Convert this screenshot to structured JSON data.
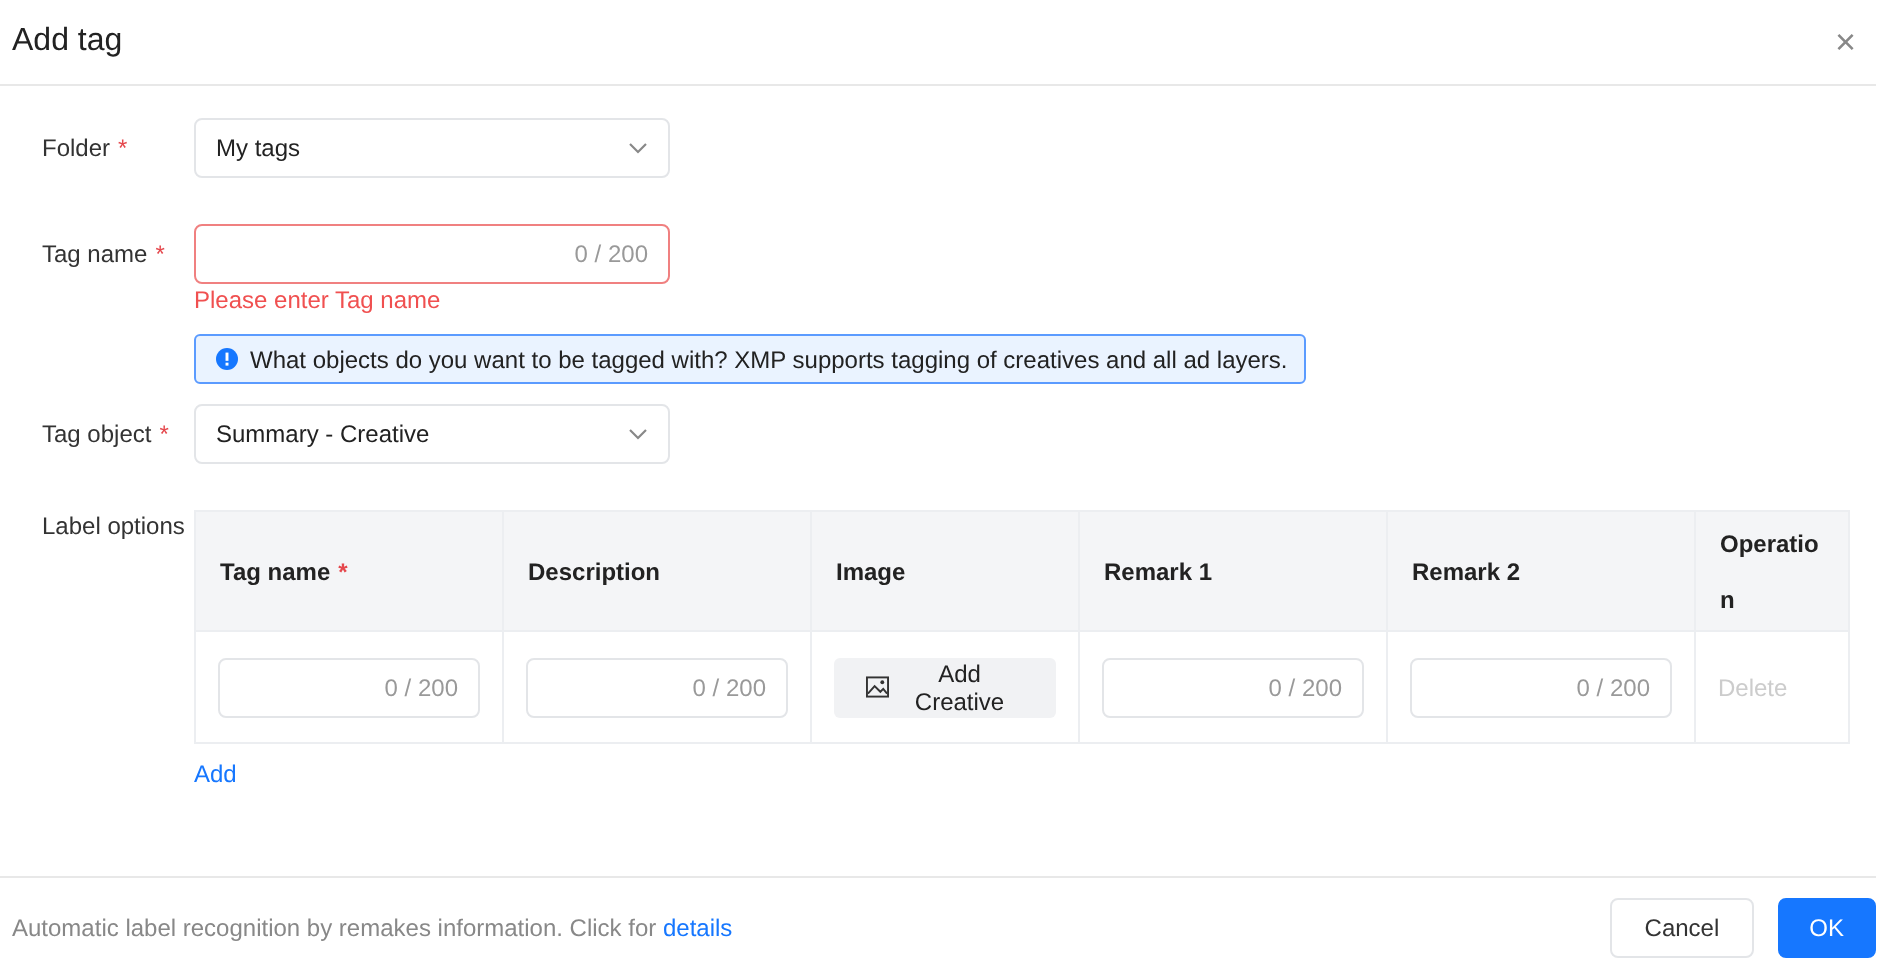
{
  "dialog": {
    "title": "Add tag",
    "close": "×"
  },
  "form": {
    "fields": [
      {
        "kind": "select",
        "label": "Folder",
        "required_mark": "*",
        "value": "My tags"
      },
      {
        "kind": "input",
        "label": "Tag name",
        "required_mark": "*",
        "counter": "0 / 200",
        "error": true,
        "error_text": "Please enter Tag name"
      },
      {
        "kind": "notice",
        "text": "What objects do you want to be tagged with? XMP supports tagging of creatives and all ad layers."
      },
      {
        "kind": "select",
        "label": "Tag object",
        "required_mark": "*",
        "value": "Summary - Creative"
      }
    ],
    "label_options": {
      "label": "Label options",
      "columns": [
        {
          "title": "Tag name",
          "required_mark": "*"
        },
        {
          "title": "Description"
        },
        {
          "title": "Image"
        },
        {
          "title": "Remark 1"
        },
        {
          "title": "Remark 2"
        },
        {
          "title": "Operation"
        }
      ],
      "rows": [
        [
          {
            "kind": "input",
            "counter": "0 / 200"
          },
          {
            "kind": "input",
            "counter": "0 / 200"
          },
          {
            "kind": "button",
            "label": "Add Creative"
          },
          {
            "kind": "input",
            "counter": "0 / 200"
          },
          {
            "kind": "input",
            "counter": "0 / 200"
          },
          {
            "kind": "action",
            "label": "Delete",
            "disabled": true
          }
        ]
      ],
      "add": "Add"
    }
  },
  "footer": {
    "note": "Automatic label recognition by remakes information. Click for",
    "link": "details",
    "buttons": [
      {
        "label": "Cancel",
        "primary": false
      },
      {
        "label": "OK",
        "primary": true
      }
    ]
  }
}
